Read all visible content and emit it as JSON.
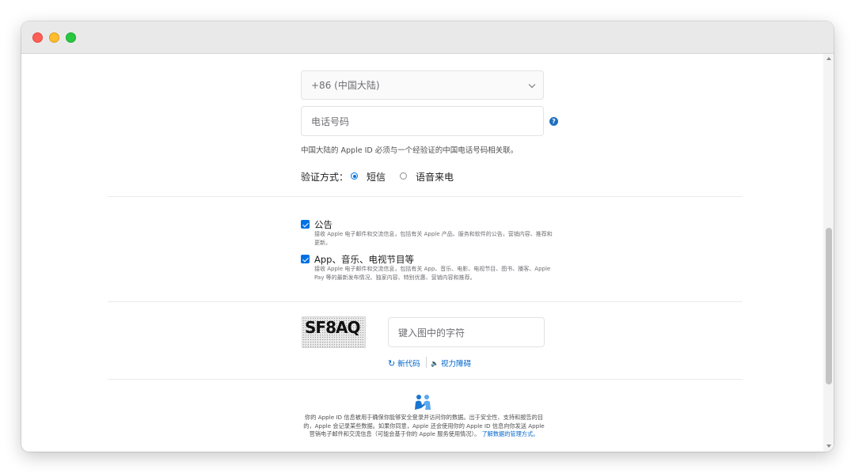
{
  "phone": {
    "country_value": "+86 (中国大陆)",
    "number_placeholder": "电话号码",
    "info_icon_glyph": "?",
    "note": "中国大陆的 Apple ID 必须与一个经验证的中国电话号码相关联。",
    "verify_label": "验证方式：",
    "options": [
      {
        "label": "短信",
        "selected": true
      },
      {
        "label": "语音来电",
        "selected": false
      }
    ]
  },
  "subscriptions": [
    {
      "title": "公告",
      "desc": "接收 Apple 电子邮件和交流信息，包括有关 Apple 产品、服务和软件的公告，营销内容、推荐和更新。",
      "checked": true
    },
    {
      "title": "App、音乐、电视节目等",
      "desc": "接收 Apple 电子邮件和交流信息，包括有关 App、音乐、电影、电视节目、图书、播客、Apple Pay 等的最新发布情况、独家内容、特别优惠、营销内容和推荐。",
      "checked": true
    }
  ],
  "captcha": {
    "image_text": "SF8AQ",
    "input_placeholder": "键入图中的字符",
    "refresh_glyph": "↻",
    "refresh_label": "新代码",
    "audio_glyph": "🔈",
    "audio_label": "视力障碍"
  },
  "footer": {
    "icon_name": "handshake-people-icon",
    "text": "你的 Apple ID 信息被用于确保你能够安全登录并访问你的数据。出于安全性、支持和报告的目的，Apple 会记录某些数据。如果你同意，Apple 还会使用你的 Apple ID 信息向你发送 Apple 营销电子邮件和交流信息（可能会基于你的 Apple 服务使用情况）。",
    "link": "了解数据的管理方式。"
  },
  "colors": {
    "accent": "#0071e3",
    "link": "#0066cc"
  }
}
